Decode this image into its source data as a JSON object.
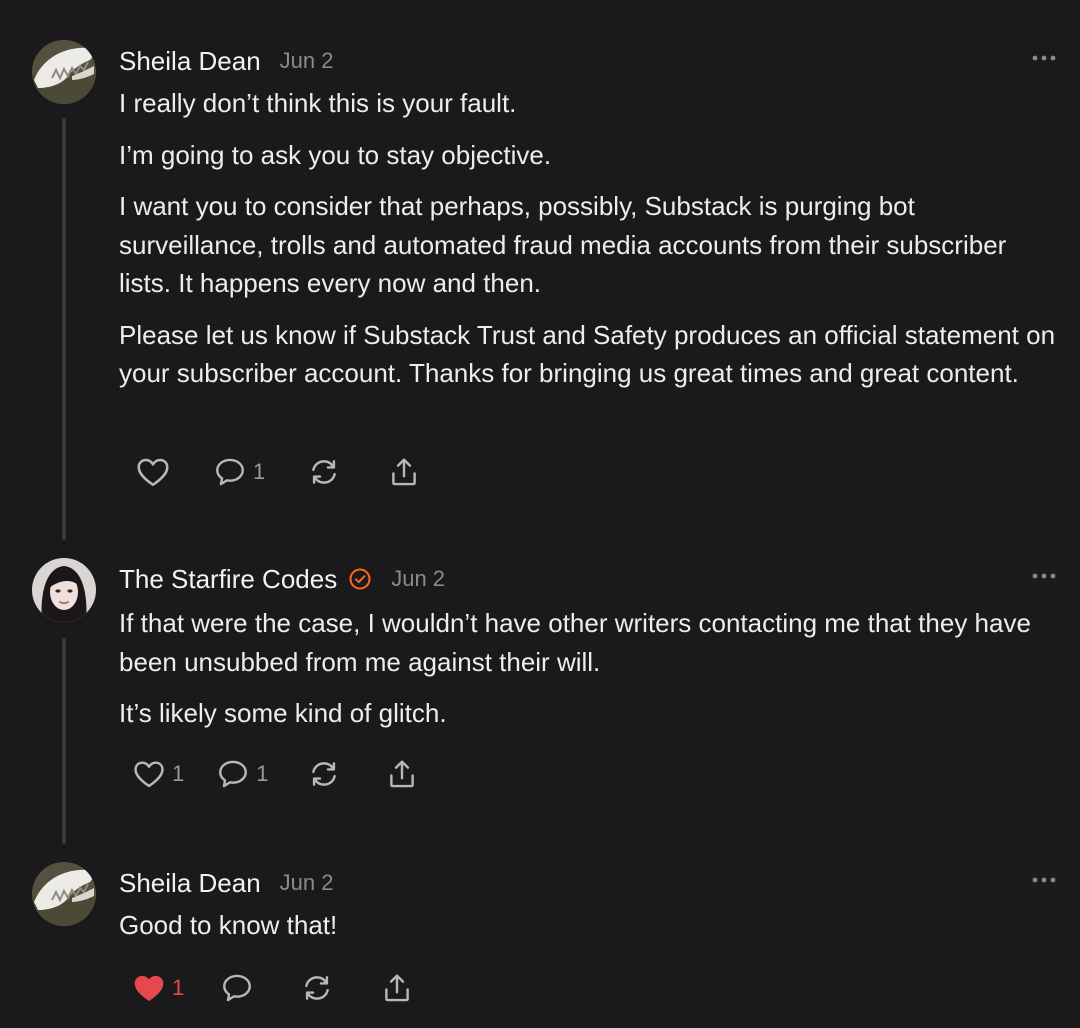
{
  "comments": [
    {
      "author": "Sheila Dean",
      "date": "Jun 2",
      "verified": false,
      "avatar_icon": "jawbone-skull-photo",
      "paragraphs": [
        "I really don’t think this is your fault.",
        "I’m going to ask you to stay objective.",
        "I want you to consider that perhaps, possibly, Substack is purging bot surveillance, trolls and automated fraud media accounts from their subscriber lists. It happens every now and then.",
        "Please let us know if Substack Trust and Safety produces an official statement on your subscriber account. Thanks for bringing us great times and great content."
      ],
      "like_count": "",
      "liked": false,
      "reply_count": "1"
    },
    {
      "author": "The Starfire Codes",
      "date": "Jun 2",
      "verified": true,
      "avatar_icon": "profile-photo",
      "paragraphs": [
        "If that were the case, I wouldn’t have other writers contacting me that they have been unsubbed from me against their will.",
        "It’s likely some kind of glitch."
      ],
      "like_count": "1",
      "liked": false,
      "reply_count": "1"
    },
    {
      "author": "Sheila Dean",
      "date": "Jun 2",
      "verified": false,
      "avatar_icon": "jawbone-skull-photo",
      "paragraphs": [
        "Good to know that!"
      ],
      "like_count": "1",
      "liked": true,
      "reply_count": ""
    }
  ],
  "colors": {
    "background": "#1a1a1c",
    "text": "#ededed",
    "muted": "#8a8a8e",
    "icon": "#b8b8bc",
    "liked": "#e5484d",
    "verified": "#ff6719",
    "thread_line": "#3a3a3d"
  }
}
